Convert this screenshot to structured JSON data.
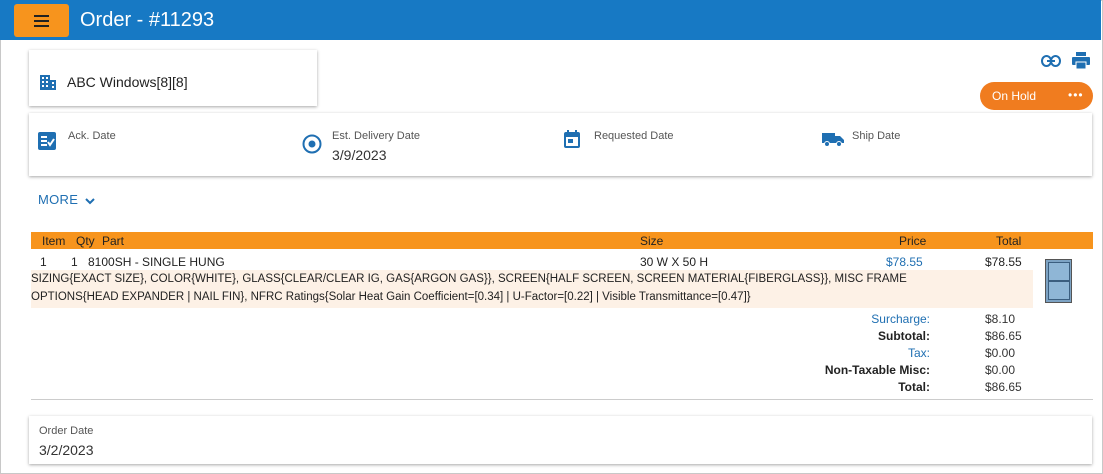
{
  "header": {
    "title": "Order - #11293"
  },
  "company": {
    "name": "ABC Windows[8][8]"
  },
  "status": {
    "label": "On Hold",
    "more": "•••"
  },
  "dates": {
    "ack": {
      "label": "Ack. Date",
      "value": ""
    },
    "est_delivery": {
      "label": "Est. Delivery Date",
      "value": "3/9/2023"
    },
    "requested": {
      "label": "Requested Date",
      "value": ""
    },
    "ship": {
      "label": "Ship Date",
      "value": ""
    }
  },
  "more_toggle": {
    "label": "MORE"
  },
  "table": {
    "headers": {
      "item": "Item",
      "qty": "Qty",
      "part": "Part",
      "size": "Size",
      "price": "Price",
      "total": "Total"
    },
    "rows": [
      {
        "item": "1",
        "qty": "1",
        "part": "8100SH - SINGLE HUNG",
        "size": "30 W X 50 H",
        "price": "$78.55",
        "total": "$78.55",
        "options_line1": "SIZING{EXACT SIZE}, COLOR{WHITE}, GLASS{CLEAR/CLEAR IG, GAS{ARGON GAS}}, SCREEN{HALF SCREEN, SCREEN MATERIAL{FIBERGLASS}}, MISC FRAME",
        "options_line2": "OPTIONS{HEAD EXPANDER | NAIL FIN}, NFRC Ratings{Solar Heat Gain Coefficient=[0.34] | U-Factor=[0.22] | Visible Transmittance=[0.47]}"
      }
    ]
  },
  "summary": {
    "surcharge": {
      "label": "Surcharge:",
      "value": "$8.10"
    },
    "subtotal": {
      "label": "Subtotal:",
      "value": "$86.65"
    },
    "tax": {
      "label": "Tax:",
      "value": "$0.00"
    },
    "non_taxable": {
      "label": "Non-Taxable Misc:",
      "value": "$0.00"
    },
    "total": {
      "label": "Total:",
      "value": "$86.65"
    }
  },
  "order_date": {
    "label": "Order Date",
    "value": "3/2/2023"
  },
  "colors": {
    "brand_blue": "#1779c4",
    "accent_orange": "#f7941d",
    "status_orange": "#f07c1f",
    "link_blue": "#1f6fb2"
  },
  "icons": [
    "menu-icon",
    "building-icon",
    "link-icon",
    "print-icon",
    "ack-checklist-icon",
    "target-icon",
    "calendar-icon",
    "truck-icon",
    "chevron-down-icon",
    "window-thumbnail"
  ]
}
